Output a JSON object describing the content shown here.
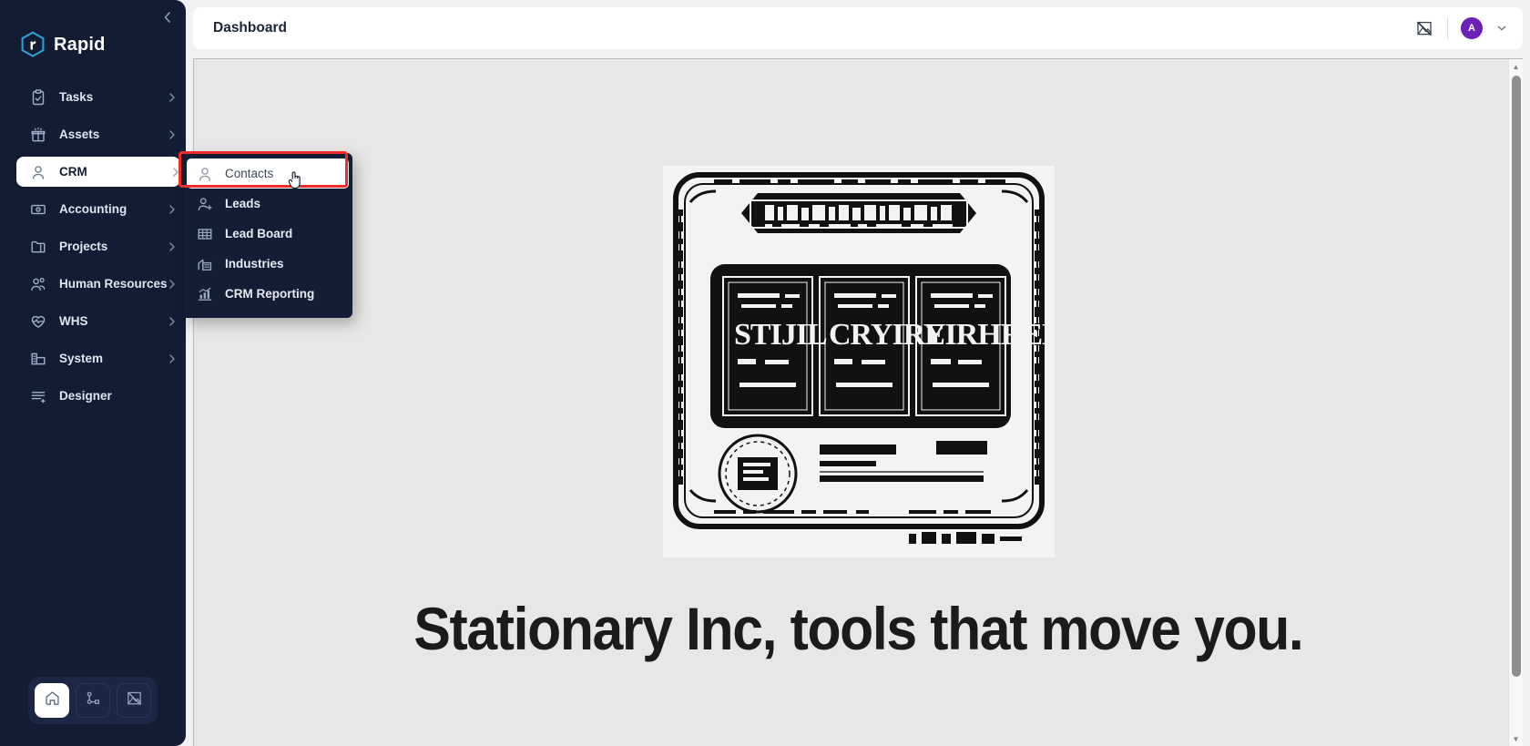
{
  "brand": {
    "name": "Rapid",
    "logo_icon": "hexagon-r-logo",
    "accent": "#2f9fd8"
  },
  "sidebar": {
    "collapse_icon": "chevron-left-icon",
    "background": "#121c33",
    "items": [
      {
        "label": "Tasks",
        "icon": "clipboard-check-icon",
        "chevron": "chevron-right-icon",
        "active": false
      },
      {
        "label": "Assets",
        "icon": "asset-box-icon",
        "chevron": "chevron-right-icon",
        "active": false
      },
      {
        "label": "CRM",
        "icon": "person-icon",
        "chevron": "chevron-right-icon",
        "active": true
      },
      {
        "label": "Accounting",
        "icon": "banknote-icon",
        "chevron": "chevron-right-icon",
        "active": false
      },
      {
        "label": "Projects",
        "icon": "folder-icon",
        "chevron": "chevron-right-icon",
        "active": false
      },
      {
        "label": "Human Resources",
        "icon": "people-icon",
        "chevron": "chevron-right-icon",
        "active": false
      },
      {
        "label": "WHS",
        "icon": "heart-pulse-icon",
        "chevron": "chevron-right-icon",
        "active": false
      },
      {
        "label": "System",
        "icon": "building-icon",
        "chevron": "chevron-right-icon",
        "active": false
      },
      {
        "label": "Designer",
        "icon": "list-plus-icon",
        "chevron": "",
        "active": false
      }
    ],
    "dock": [
      {
        "icon": "home-icon",
        "active": true
      },
      {
        "icon": "workflow-node-icon",
        "active": false
      },
      {
        "icon": "broken-image-icon",
        "active": false
      }
    ]
  },
  "submenu": {
    "parent": "CRM",
    "highlight_color": "#f02b2b",
    "items": [
      {
        "label": "Contacts",
        "icon": "person-icon",
        "highlighted": true
      },
      {
        "label": "Leads",
        "icon": "person-plus-icon",
        "highlighted": false
      },
      {
        "label": "Lead Board",
        "icon": "board-grid-icon",
        "highlighted": false
      },
      {
        "label": "Industries",
        "icon": "factory-icon",
        "highlighted": false
      },
      {
        "label": "CRM Reporting",
        "icon": "bar-chart-icon",
        "highlighted": false
      }
    ]
  },
  "topbar": {
    "title": "Dashboard",
    "broken_image_icon": "broken-image-icon",
    "avatar_initial": "A",
    "avatar_color": "#6b21b6",
    "caret_icon": "chevron-down-icon"
  },
  "content": {
    "poster_alt": "vintage engraved stationery poster",
    "headline": "Stationary Inc, tools that move you.",
    "background": "#e8e7e5"
  },
  "cursor": {
    "type": "pointer-hand-cursor"
  }
}
